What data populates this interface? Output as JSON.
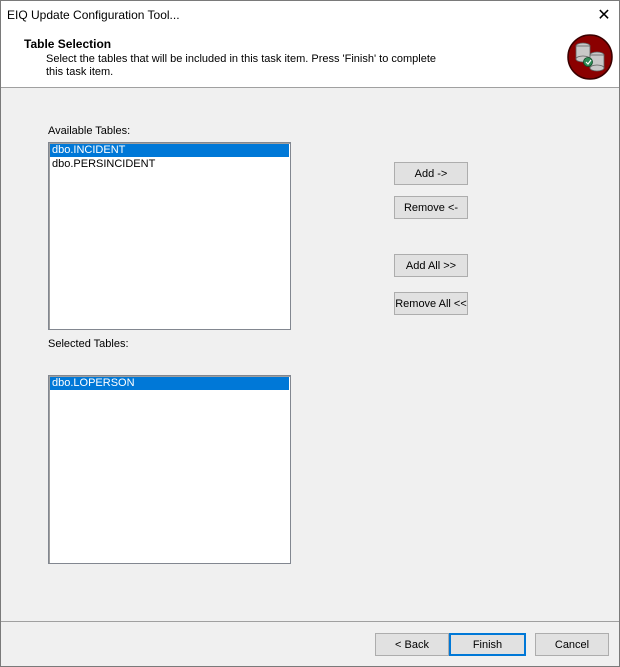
{
  "window": {
    "title": "EIQ Update Configuration Tool..."
  },
  "header": {
    "title": "Table Selection",
    "description": "Select the tables that will be included in this task item.  Press 'Finish' to complete this task item.",
    "logo_icon": "database-wizard-icon"
  },
  "available": {
    "label": "Available Tables:",
    "items": [
      {
        "text": "dbo.INCIDENT",
        "selected": true
      },
      {
        "text": "dbo.PERSINCIDENT",
        "selected": false
      }
    ]
  },
  "selected": {
    "label": "Selected Tables:",
    "items": [
      {
        "text": "dbo.LOPERSON",
        "selected": true
      }
    ]
  },
  "buttons": {
    "add": "Add ->",
    "remove": "Remove <-",
    "add_all": "Add All >>",
    "remove_all": "Remove All <<",
    "back": "< Back",
    "finish": "Finish",
    "cancel": "Cancel"
  },
  "colors": {
    "selection": "#0078d7",
    "logo_bg": "#8b0000"
  }
}
